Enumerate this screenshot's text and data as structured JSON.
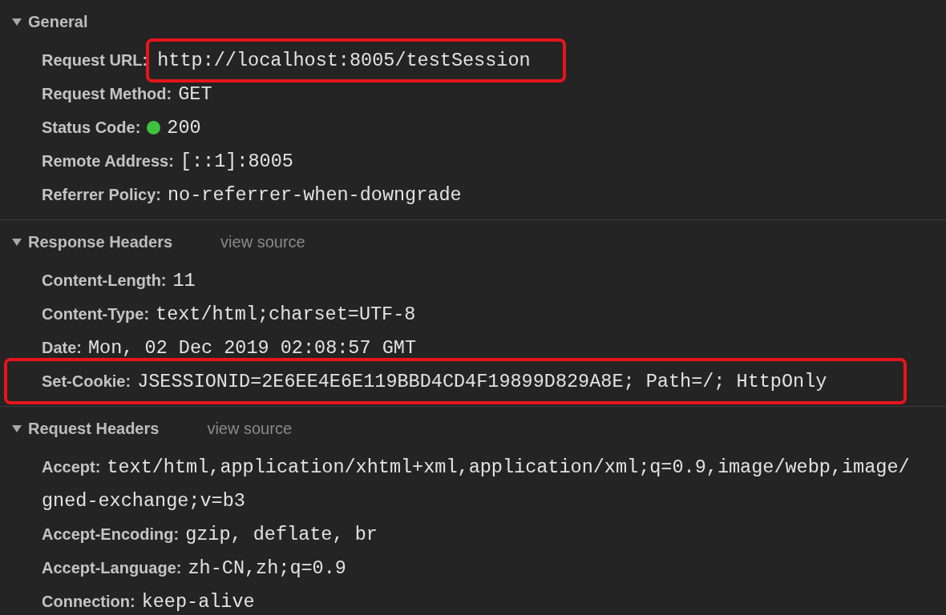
{
  "sections": [
    {
      "title": "General",
      "expanded": true,
      "rows": [
        {
          "key": "Request URL:",
          "value": "http://localhost:8005/testSession",
          "value_highlighted": true
        },
        {
          "key": "Request Method:",
          "value": "GET"
        },
        {
          "key": "Status Code:",
          "value": "200",
          "color": "#3fc23f"
        },
        {
          "key": "Remote Address:",
          "value": "[::1]:8005"
        },
        {
          "key": "Referrer Policy:",
          "value": "no-referrer-when-downgrade"
        }
      ]
    },
    {
      "title": "Response Headers",
      "expanded": true,
      "link": "view source",
      "rows": [
        {
          "key": "Content-Length:",
          "value": "11"
        },
        {
          "key": "Content-Type:",
          "value": "text/html;charset=UTF-8"
        },
        {
          "key": "Date:",
          "value": "Mon, 02 Dec 2019 02:08:57 GMT"
        },
        {
          "key": "Set-Cookie:",
          "value": "JSESSIONID=2E6EE4E6E119BBD4CD4F19899D829A8E; Path=/; HttpOnly",
          "row_highlighted": true
        }
      ]
    },
    {
      "title": "Request Headers",
      "expanded": true,
      "link": "view source",
      "rows": [
        {
          "key": "Accept:",
          "value": "text/html,application/xhtml+xml,application/xml;q=0.9,image/webp,image/"
        },
        {
          "kind": "continuation",
          "value": "gned-exchange;v=b3"
        },
        {
          "key": "Accept-Encoding:",
          "value": "gzip, deflate, br"
        },
        {
          "key": "Accept-Language:",
          "value": "zh-CN,zh;q=0.9"
        },
        {
          "key": "Connection:",
          "value": "keep-alive"
        }
      ]
    }
  ]
}
